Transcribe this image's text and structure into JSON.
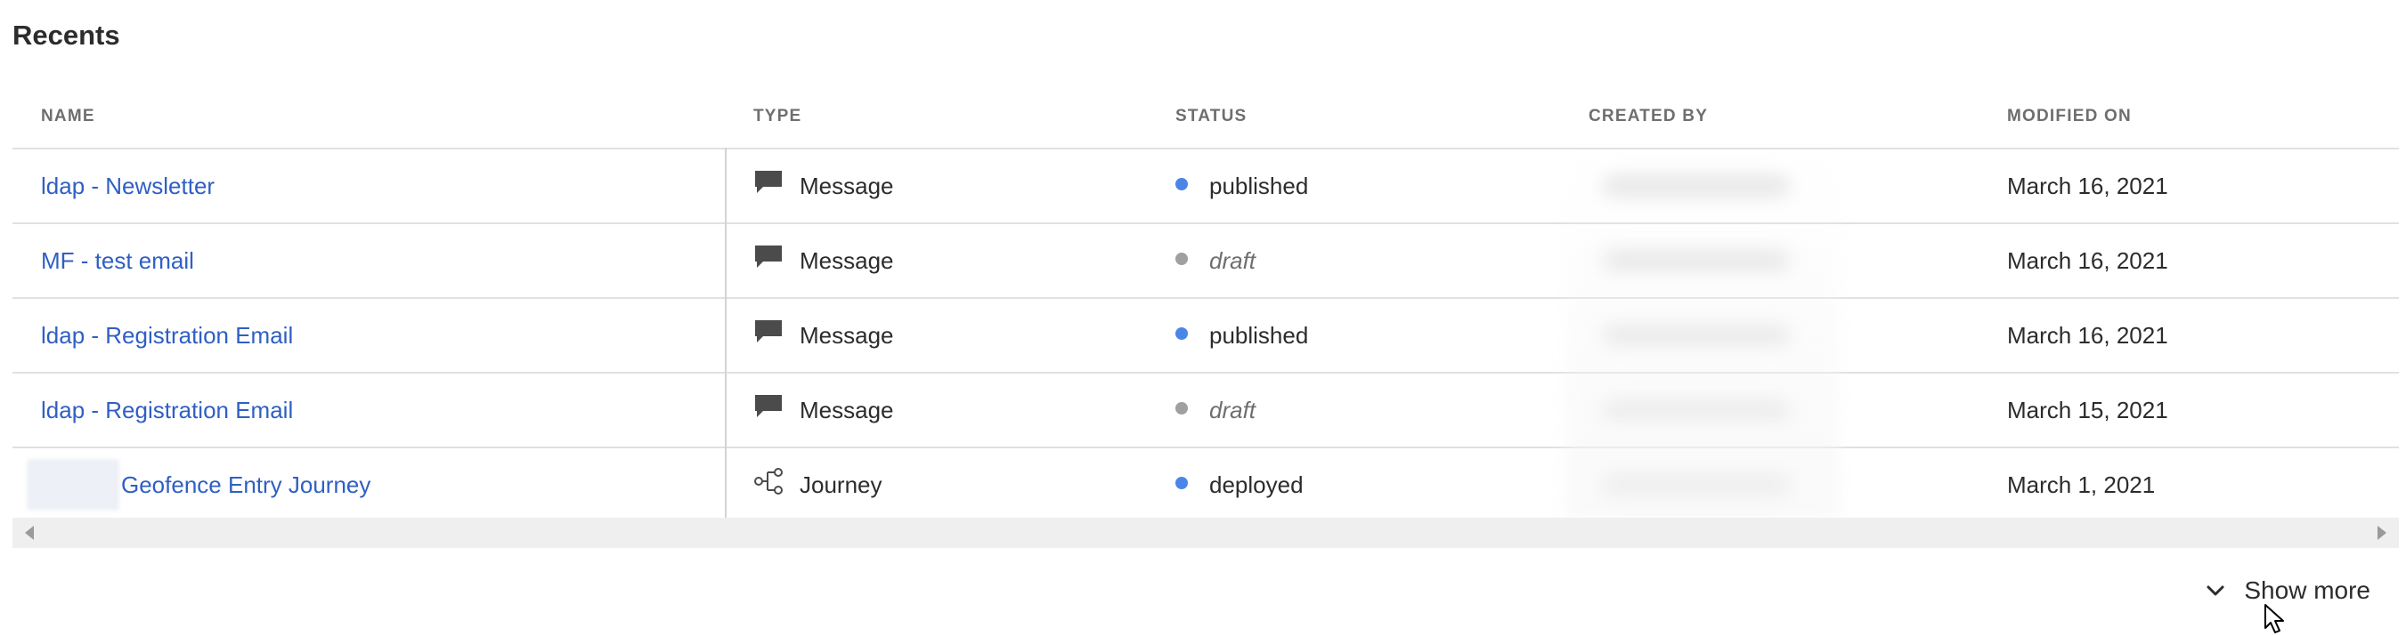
{
  "section": {
    "title": "Recents"
  },
  "table": {
    "columns": [
      "NAME",
      "TYPE",
      "STATUS",
      "CREATED BY",
      "MODIFIED ON"
    ],
    "rows": [
      {
        "name": "ldap - Newsletter",
        "type": "Message",
        "type_icon": "message-icon",
        "status": "published",
        "status_color": "#4a86e8",
        "modified_on": "March 16, 2021"
      },
      {
        "name": "MF - test email",
        "type": "Message",
        "type_icon": "message-icon",
        "status": "draft",
        "status_color": "#a0a0a0",
        "modified_on": "March 16, 2021"
      },
      {
        "name": "ldap - Registration Email",
        "type": "Message",
        "type_icon": "message-icon",
        "status": "published",
        "status_color": "#4a86e8",
        "modified_on": "March 16, 2021"
      },
      {
        "name": "ldap - Registration Email",
        "type": "Message",
        "type_icon": "message-icon",
        "status": "draft",
        "status_color": "#a0a0a0",
        "modified_on": "March 15, 2021"
      },
      {
        "name": "Geofence Entry Journey",
        "type": "Journey",
        "type_icon": "journey-icon",
        "status": "deployed",
        "status_color": "#4a86e8",
        "modified_on": "March 1, 2021"
      }
    ]
  },
  "footer": {
    "show_more_label": "Show more"
  },
  "colors": {
    "link": "#2f5fc4",
    "published": "#4a86e8",
    "draft": "#a0a0a0",
    "deployed": "#4a86e8"
  }
}
